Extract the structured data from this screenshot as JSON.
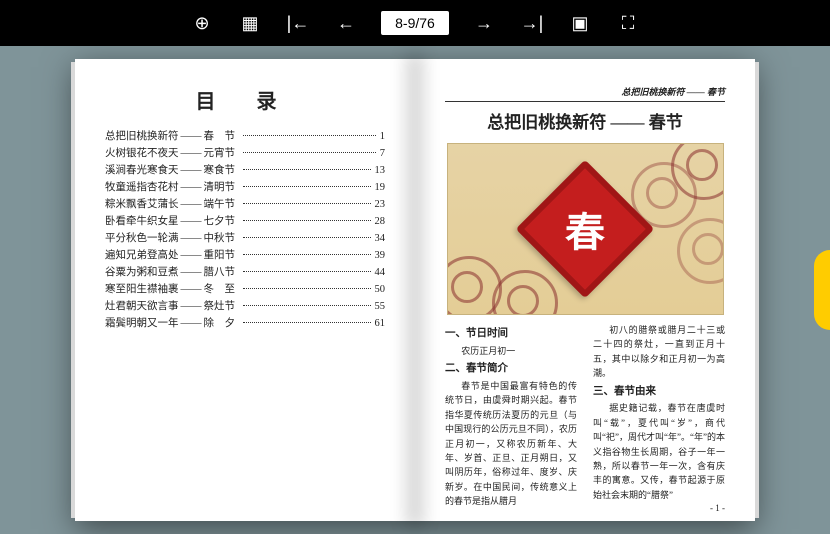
{
  "toolbar": {
    "page_indicator": "8-9/76",
    "icons": {
      "zoom": "⊕",
      "thumbs": "▦",
      "first": "|←",
      "prev": "←",
      "next": "→",
      "last": "→|",
      "single": "▣",
      "full": "⛶"
    }
  },
  "left": {
    "title": "目 录",
    "toc": [
      {
        "t1": "总把旧桃换新符",
        "t2": "春　节",
        "pg": "1"
      },
      {
        "t1": "火树银花不夜天",
        "t2": "元宵节",
        "pg": "7"
      },
      {
        "t1": "溪涧春光寒食天",
        "t2": "寒食节",
        "pg": "13"
      },
      {
        "t1": "牧童遥指杏花村",
        "t2": "清明节",
        "pg": "19"
      },
      {
        "t1": "粽米飘香艾蒲长",
        "t2": "端午节",
        "pg": "23"
      },
      {
        "t1": "卧看牵牛织女星",
        "t2": "七夕节",
        "pg": "28"
      },
      {
        "t1": "平分秋色一轮满",
        "t2": "中秋节",
        "pg": "34"
      },
      {
        "t1": "遍知兄弟登高处",
        "t2": "重阳节",
        "pg": "39"
      },
      {
        "t1": "谷粟为粥和豆煮",
        "t2": "腊八节",
        "pg": "44"
      },
      {
        "t1": "寒至阳生襟袖裹",
        "t2": "冬　至",
        "pg": "50"
      },
      {
        "t1": "灶君朝天欲言事",
        "t2": "祭灶节",
        "pg": "55"
      },
      {
        "t1": "霜鬓明朝又一年",
        "t2": "除　夕",
        "pg": "61"
      }
    ],
    "sep": "——"
  },
  "right": {
    "running_head": "总把旧桃换新符 —— 春节",
    "title": "总把旧桃换新符 —— 春节",
    "hero_char": "春",
    "sections": {
      "s1_h": "一、节日时间",
      "s1_p": "农历正月初一",
      "s2_h": "二、春节简介",
      "s2_p1": "春节是中国最富有特色的传统节日，由虞舜时期兴起。春节指华夏传统历法夏历的元旦（与中国现行的公历元旦不同），农历正月初一，又称农历新年、大年、岁首、正旦、正月朔日，又叫阴历年，俗称过年、度岁、庆新岁。在中国民间，传统意义上的春节是指从腊月",
      "s2_p2": "初八的腊祭或腊月二十三或二十四的祭灶，一直到正月十五，其中以除夕和正月初一为高潮。",
      "s3_h": "三、春节由来",
      "s3_p1": "据史籍记载，春节在唐虞时叫“载”，夏代叫“岁”，商代叫“祀”，周代才叫“年”。“年”的本义指谷物生长周期，谷子一年一熟，所以春节一年一次，含有庆丰的寓意。又传，春节起源于原始社会末期的“腊祭”"
    },
    "page_number": "- 1 -"
  }
}
